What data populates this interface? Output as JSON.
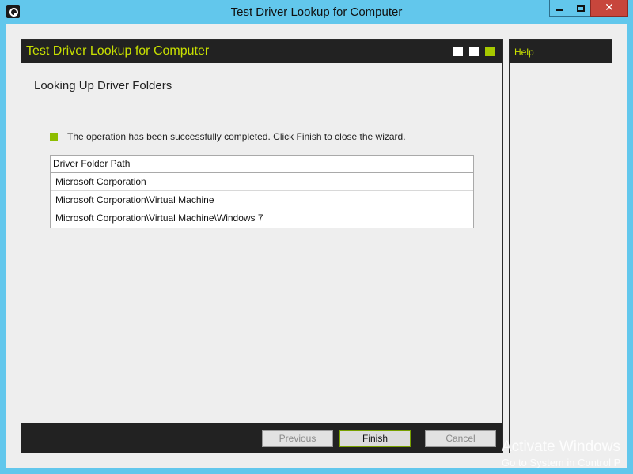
{
  "window": {
    "title": "Test Driver Lookup for Computer",
    "controls": {
      "minimize_icon": "minimize-icon",
      "maximize_icon": "maximize-icon",
      "close_glyph": "✕"
    }
  },
  "wizard": {
    "header_title": "Test Driver Lookup for Computer",
    "steps_total": 3,
    "current_step": 3,
    "page_heading": "Looking Up Driver Folders",
    "status_message": "The operation has been successfully completed. Click Finish to close the wizard.",
    "table": {
      "header": "Driver Folder Path",
      "rows": [
        "Microsoft Corporation",
        "Microsoft Corporation\\Virtual Machine",
        "Microsoft Corporation\\Virtual Machine\\Windows 7"
      ]
    },
    "buttons": {
      "previous": "Previous",
      "finish": "Finish",
      "cancel": "Cancel"
    }
  },
  "help": {
    "title": "Help"
  },
  "watermark": {
    "line1": "Activate Windows",
    "line2": "Go to System in Control P"
  },
  "colors": {
    "window_frame": "#62c7ec",
    "accent_lime": "#c8e000",
    "status_green": "#8dbd00",
    "panel_dark": "#222222",
    "close_red": "#c7463c"
  }
}
